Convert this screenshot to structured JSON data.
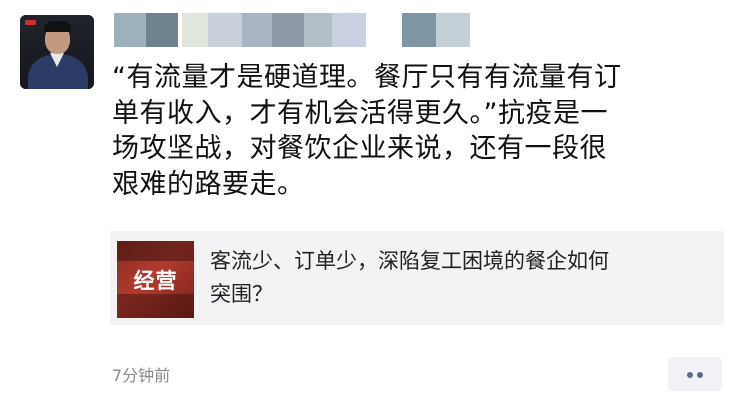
{
  "post": {
    "text": "“有流量才是硬道理。餐厅只有有流量有订\n单有收入，才有机会活得更久。”抗疫是一\n场攻坚战，对餐饮企业来说，还有一段很\n艰难的路要走。"
  },
  "link_card": {
    "thumbnail_label": "经营",
    "title": "客流少、订单少，深陷复工困境的餐企如何\n突围？"
  },
  "footer": {
    "timestamp": "7分钟前",
    "more_icon": "more-dots-icon"
  },
  "colors": {
    "card_background": "#f3f3f5",
    "timestamp": "#8a8a8a",
    "more_dots": "#5d6b8a"
  }
}
